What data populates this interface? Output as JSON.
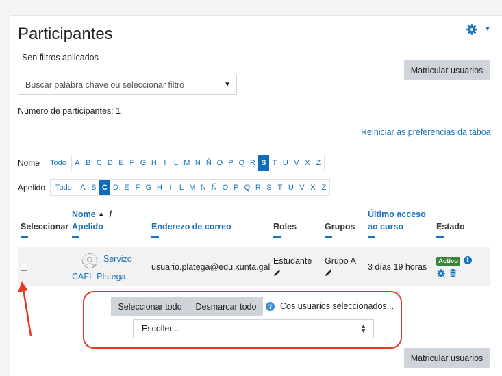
{
  "page": {
    "title": "Participantes",
    "filters_note": "Sen filtros aplicados",
    "enrol_button": "Matricular usuarios",
    "filter_placeholder": "Buscar palabra chave ou seleccionar filtro",
    "participant_count": "Número de participantes: 1",
    "reset_preferences": "Reiniciar as preferencias da táboa",
    "accent_color": "#1a73b9",
    "annotation_color": "#e8371f"
  },
  "initials": {
    "first_name_label": "Nome",
    "last_name_label": "Apelido",
    "all_label": "Todo",
    "letters": [
      "A",
      "B",
      "C",
      "D",
      "E",
      "F",
      "G",
      "H",
      "I",
      "L",
      "M",
      "N",
      "Ñ",
      "O",
      "P",
      "Q",
      "R",
      "S",
      "T",
      "U",
      "V",
      "X",
      "Z"
    ],
    "first_name_selected": "S",
    "last_name_selected": "C"
  },
  "table": {
    "headers": {
      "select": "Seleccionar",
      "first_name": "Nome",
      "sort_arrow": "▲",
      "slash": "/",
      "last_name": "Apelido",
      "email": "Enderezo de correo",
      "roles": "Roles",
      "groups": "Grupos",
      "last_access_line1": "Último acceso",
      "last_access_line2": "ao curso",
      "status": "Estado"
    },
    "rows": [
      {
        "name_line1": "Servizo",
        "name_line2": "CAFI- Plategа",
        "email": "usuario.platega@edu.xunta.gal",
        "role": "Estudante",
        "group": "Grupo A",
        "last_access": "3 días 19 horas",
        "status_badge": "Activo",
        "info_glyph": "i"
      }
    ]
  },
  "bulk": {
    "select_all": "Seleccionar todo",
    "deselect_all": "Desmarcar todo",
    "help_glyph": "?",
    "with_selected": "Cos usuarios seleccionados...",
    "choose": "Escoller..."
  }
}
